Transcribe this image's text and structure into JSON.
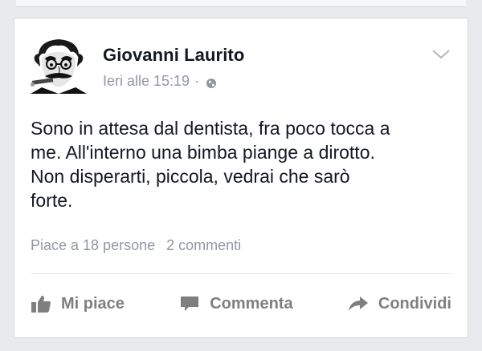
{
  "post": {
    "author_name": "Giovanni Laurito",
    "timestamp": "Ieri alle 15:19",
    "separator": "·",
    "privacy_icon": "globe-icon",
    "menu_icon": "chevron-down-icon",
    "text_lines": [
      "Sono in attesa dal dentista, fra poco tocca a",
      "me. All'interno una bimba piange a dirotto.",
      "Non disperarti, piccola, vedrai che sarò",
      "forte."
    ],
    "likes_text": "Piace a 18 persone",
    "comments_text": "2 commenti"
  },
  "actions": {
    "like_label": "Mi piace",
    "comment_label": "Commenta",
    "share_label": "Condividi",
    "like_icon": "thumbs-up-icon",
    "comment_icon": "speech-bubble-icon",
    "share_icon": "share-arrow-icon"
  },
  "colors": {
    "background": "#e9eaed",
    "card": "#ffffff",
    "text": "#141823",
    "muted": "#9197a3",
    "action": "#7f7f7f"
  }
}
